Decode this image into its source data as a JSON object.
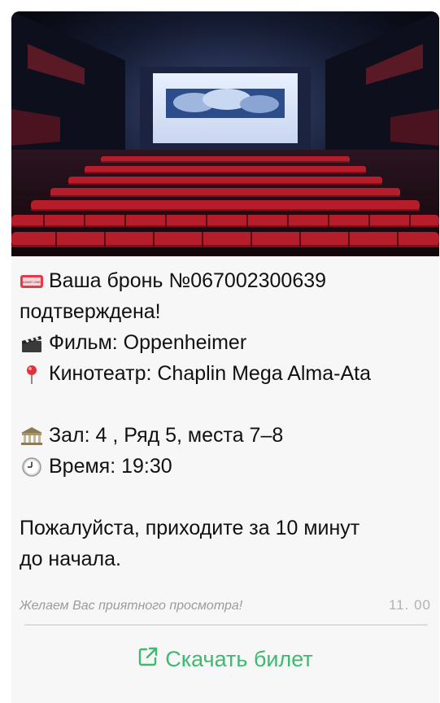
{
  "message": {
    "booking_line": "Ваша бронь №067002300639",
    "confirmed_line": "подтверждена!",
    "film_line": "Фильм: Oppenheimer",
    "cinema_line": "Кинотеатр: Chaplin Mega Alma-Ata",
    "hall_line": "Зал: 4 , Ряд 5, места 7–8",
    "time_line": "Время: 19:30",
    "arrive_line_1": "Пожалуйста, приходите за 10 минут",
    "arrive_line_2": "до начала.",
    "ticket_emoji_text": "ADMIT ONE"
  },
  "footer": {
    "note": "Желаем Вас приятного просмотра!",
    "timestamp": "11. 00"
  },
  "action": {
    "download_label": "Скачать билет",
    "icon": "external-link-icon"
  },
  "colors": {
    "accent": "#3dba6f",
    "card_bg": "#f7f7f7",
    "muted": "#9b9b9b"
  },
  "icons": [
    "ticket-icon",
    "clapper-icon",
    "pin-icon",
    "classical-building-icon",
    "clock-icon",
    "external-link-icon"
  ]
}
